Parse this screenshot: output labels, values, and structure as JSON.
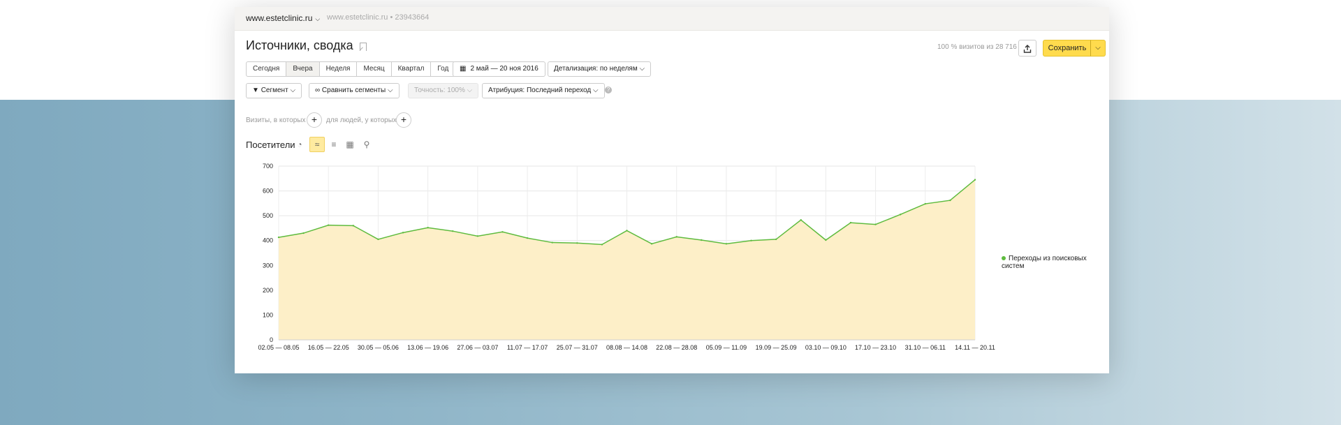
{
  "header": {
    "site": "www.estetclinic.ru",
    "site_meta": "www.estetclinic.ru • 23943664"
  },
  "report": {
    "title": "Источники, сводка",
    "visits_share": "100 % визитов из 28 716",
    "save_label": "Сохранить"
  },
  "periods": [
    "Сегодня",
    "Вчера",
    "Неделя",
    "Месяц",
    "Квартал",
    "Год"
  ],
  "active_period": "Вчера",
  "date_range": "2 май — 20 ноя 2016",
  "detail": "Детализация: по неделям",
  "controls": {
    "segment": "Сегмент",
    "compare": "Сравнить сегменты",
    "accuracy": "Точность: 100%",
    "attribution": "Атрибуция: Последний переход",
    "help": "?"
  },
  "segments": {
    "visits_label": "Визиты, в которых",
    "people_label": "для людей, у которых"
  },
  "metric": {
    "label": "Посетители",
    "chart_type_icons": [
      "pie-chart-icon",
      "area-chart-icon",
      "stacked-chart-icon",
      "bar-chart-icon",
      "map-pin-icon"
    ]
  },
  "chart_data": {
    "type": "area",
    "title": "",
    "xlabel": "",
    "ylabel": "",
    "ylim": [
      0,
      700
    ],
    "yticks": [
      0,
      100,
      200,
      300,
      400,
      500,
      600,
      700
    ],
    "x_tick_labels": [
      "02.05 — 08.05",
      "16.05 — 22.05",
      "30.05 — 05.06",
      "13.06 — 19.06",
      "27.06 — 03.07",
      "11.07 — 17.07",
      "25.07 — 31.07",
      "08.08 — 14.08",
      "22.08 — 28.08",
      "05.09 — 11.09",
      "19.09 — 25.09",
      "03.10 — 09.10",
      "17.10 — 23.10",
      "31.10 — 06.11",
      "14.11 — 20.11"
    ],
    "grid": true,
    "legend_position": "right",
    "series": [
      {
        "name": "Переходы из поисковых систем",
        "color": "#5ebb3e",
        "fill": "#fdefc8",
        "values": [
          413,
          430,
          462,
          460,
          405,
          432,
          452,
          438,
          418,
          435,
          410,
          392,
          390,
          384,
          440,
          387,
          415,
          402,
          387,
          400,
          405,
          483,
          402,
          472,
          465,
          505,
          548,
          562,
          645
        ]
      }
    ]
  }
}
